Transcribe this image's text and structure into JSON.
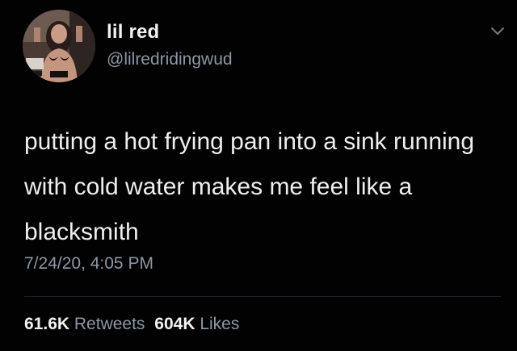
{
  "author": {
    "display_name": "lil red",
    "handle": "@lilredridingwud",
    "avatar_icon": "profile-photo"
  },
  "tweet": {
    "text": "putting a hot frying pan into a sink running with cold water makes me feel like a blacksmith",
    "timestamp": "7/24/20, 4:05 PM"
  },
  "stats": {
    "retweets_count": "61.6K",
    "retweets_label": "Retweets",
    "likes_count": "604K",
    "likes_label": "Likes"
  },
  "menu_icon": "chevron-down-icon",
  "colors": {
    "background": "#020203",
    "primary_text": "#eeeeee",
    "secondary_text": "#8b98a5"
  }
}
